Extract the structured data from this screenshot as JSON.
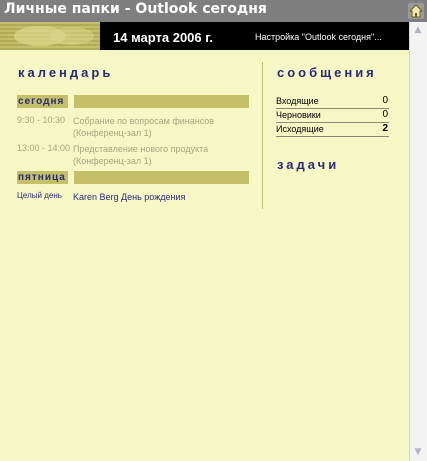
{
  "window": {
    "title": "Личные папки - Outlook сегодня",
    "home_icon": "home-icon"
  },
  "banner": {
    "date": "14 марта 2006 г.",
    "setup_link": "Настройка \"Outlook сегодня\"..."
  },
  "calendar": {
    "title": "календарь",
    "days": [
      {
        "label": "сегодня",
        "events": [
          {
            "time": "9:30 - 10:30",
            "subject": "Собрание по вопросам финансов",
            "location": "(Конференц-зал 1)"
          },
          {
            "time": "13:00 - 14:00",
            "subject": "Представление нового продукта",
            "location": "(Конференц-зал 1)"
          }
        ]
      },
      {
        "label": "пятница",
        "events": [
          {
            "time": "Целый день",
            "subject": "Karen Berg День рождения"
          }
        ]
      }
    ]
  },
  "messages": {
    "title": "сообщения",
    "rows": [
      {
        "label": "Входящие",
        "count": "0"
      },
      {
        "label": "Черновики",
        "count": "0"
      },
      {
        "label": "Исходящие",
        "count": "2"
      }
    ]
  },
  "tasks": {
    "title": "задачи"
  },
  "colors": {
    "background": "#f7f7c6",
    "accent_bar": "#c4c06a",
    "heading": "#2a2a7a",
    "muted_text": "#a8a47c",
    "titlebar": "#7f7f7f"
  }
}
